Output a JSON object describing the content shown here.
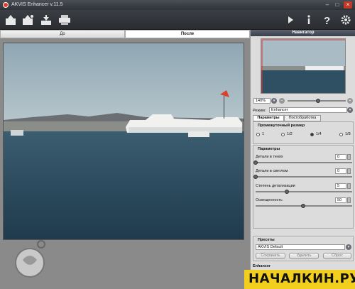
{
  "window": {
    "title": "AKVIS Enhancer v.11.5"
  },
  "tabs": {
    "before": "До",
    "after": "После"
  },
  "navigator": {
    "title": "Навигатор",
    "zoom": "140%"
  },
  "mode": {
    "label": "Режим:",
    "value": "Enhancer"
  },
  "subtabs": {
    "params": "Параметры",
    "post": "Постобработка"
  },
  "intermediate": {
    "title": "Промежуточный размер",
    "options": [
      "1",
      "1/2",
      "1/4",
      "1/8"
    ],
    "selected": "1/4"
  },
  "params": {
    "title": "Параметры",
    "shadows": {
      "label": "Детали в тенях",
      "value": "0"
    },
    "highlights": {
      "label": "Детали в светлом",
      "value": "0"
    },
    "detail": {
      "label": "Степень детализации",
      "value": "5"
    },
    "lightness": {
      "label": "Освещенность",
      "value": "50"
    }
  },
  "presets": {
    "title": "Пресеты",
    "current": "AKVIS Default",
    "save": "Сохранить",
    "delete": "Удалить",
    "reset": "Сброс"
  },
  "status": {
    "mode": "Enhancer"
  },
  "watermark": "НАЧАЛКИН.РУ",
  "colors": {
    "accent": "#f3cf1d",
    "toolbar": "#2f3237",
    "panel_header": "#4a5060"
  }
}
